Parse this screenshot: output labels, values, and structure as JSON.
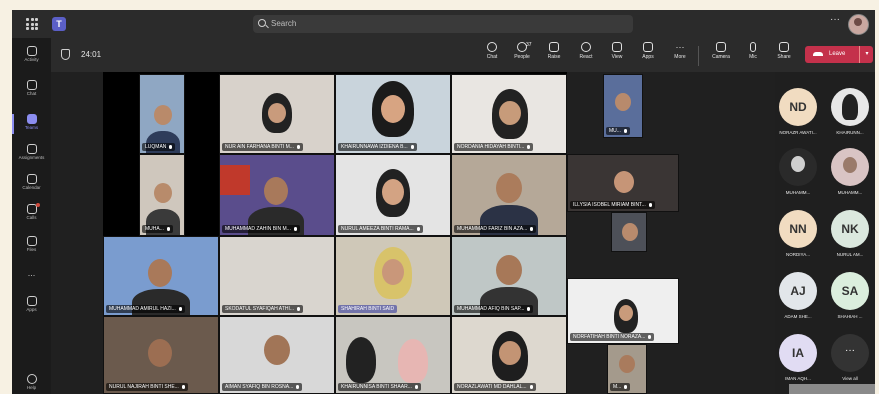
{
  "search": {
    "placeholder": "Search"
  },
  "rail": [
    {
      "label": "Activity",
      "name": "rail-activity"
    },
    {
      "label": "Chat",
      "name": "rail-chat"
    },
    {
      "label": "Teams",
      "name": "rail-teams"
    },
    {
      "label": "Assignments",
      "name": "rail-assignments"
    },
    {
      "label": "Calendar",
      "name": "rail-calendar"
    },
    {
      "label": "Calls",
      "name": "rail-calls"
    },
    {
      "label": "Files",
      "name": "rail-files"
    },
    {
      "label": "...",
      "name": "rail-more"
    },
    {
      "label": "Apps",
      "name": "rail-apps"
    },
    {
      "label": "Help",
      "name": "rail-help"
    }
  ],
  "meeting": {
    "timer": "24:01",
    "tools": [
      {
        "label": "Chat",
        "icon": "chat-icon"
      },
      {
        "label": "People",
        "icon": "people-icon",
        "badge": "37"
      },
      {
        "label": "Raise",
        "icon": "raise-hand-icon"
      },
      {
        "label": "React",
        "icon": "react-icon"
      },
      {
        "label": "View",
        "icon": "view-icon"
      },
      {
        "label": "Apps",
        "icon": "apps-icon"
      },
      {
        "label": "More",
        "icon": "more-icon"
      },
      {
        "label": "Camera",
        "icon": "camera-icon"
      },
      {
        "label": "Mic",
        "icon": "mic-icon"
      },
      {
        "label": "Share",
        "icon": "share-icon"
      }
    ],
    "leave_label": "Leave"
  },
  "tiles": [
    {
      "name": "LUQMAN"
    },
    {
      "name": "NUR AIN FARHANA BINTI M..."
    },
    {
      "name": "KHAIRUNNAWA IZDIENA B..."
    },
    {
      "name": "NORDANIA HIDAYAH BINTI..."
    },
    {
      "name": "MU..."
    },
    {
      "name": "MUHA..."
    },
    {
      "name": "MUHAMMAD ZAHIN BIN M..."
    },
    {
      "name": "NURUL AMEEZA BINTI RAMA..."
    },
    {
      "name": "MUHAMMAD FARIZ BIN AZA..."
    },
    {
      "name": "ILLYSIA ISOBEL MIRIAM BINT..."
    },
    {
      "name": "MUHAMMAD AMIRUL HAZI..."
    },
    {
      "name": "SKODATUL SYAFIQAH ATHI..."
    },
    {
      "name": "SHAHIRAH BINTI SAID"
    },
    {
      "name": "MUHAMMAD AFIQ BIN SAP..."
    },
    {
      "name": "NORFATIHAH BINTI NORAZA..."
    },
    {
      "name": "NURUL NAJIRAH BINTI SHE..."
    },
    {
      "name": "AIMAN SYAFIQ BIN ROSNA..."
    },
    {
      "name": "KHAIRUNNISA BINTI SHAAR..."
    },
    {
      "name": "NORAZLAWATI MD DAHLAL..."
    },
    {
      "name": "M..."
    }
  ],
  "participants": [
    {
      "initials": "ND",
      "label": "NORAZR AWATI...",
      "color": "#f1dcc1"
    },
    {
      "initials": "",
      "label": "KHAIRUNN...",
      "color": "#e7e7e7"
    },
    {
      "initials": "",
      "label": "MUHAMM...",
      "color": "#2a2a2a"
    },
    {
      "initials": "",
      "label": "MUHAMM...",
      "color": "#d9c4c4"
    },
    {
      "initials": "NN",
      "label": "NORDIYA...",
      "color": "#f1dcc1"
    },
    {
      "initials": "NK",
      "label": "NURUL AM...",
      "color": "#dbe8de"
    },
    {
      "initials": "AJ",
      "label": "ADAM SHE...",
      "color": "#e2e6ea"
    },
    {
      "initials": "SA",
      "label": "SHAHIAH ...",
      "color": "#dbeedd"
    },
    {
      "initials": "IA",
      "label": "IMAN AQH...",
      "color": "#e1dcf3"
    }
  ],
  "view_all_label": "View all"
}
